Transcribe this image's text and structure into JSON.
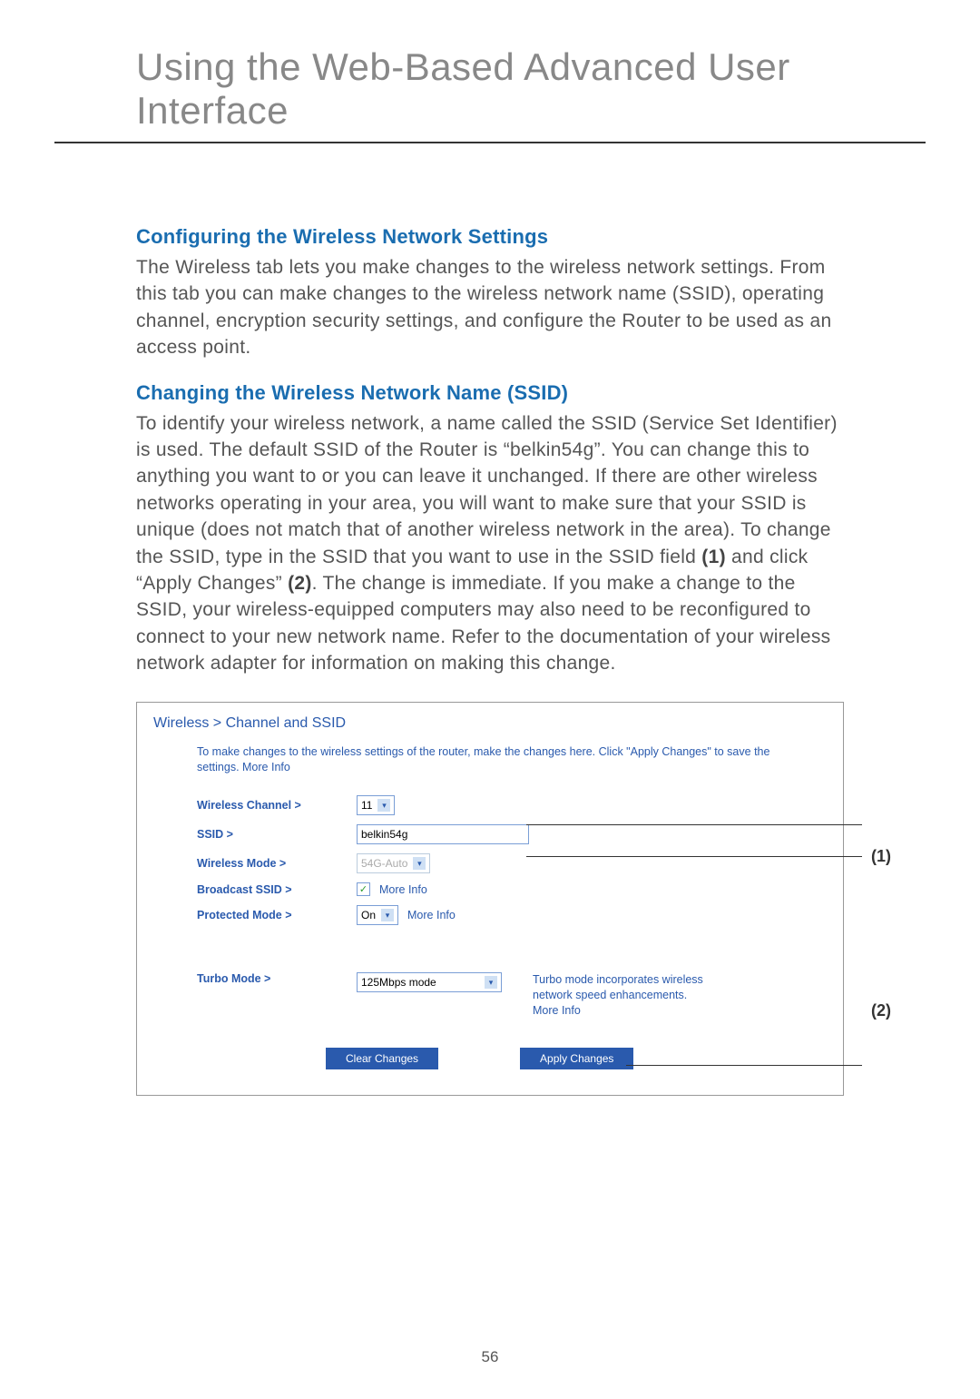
{
  "page_title": "Using the Web-Based Advanced User Interface",
  "page_number": "56",
  "sections": {
    "s1_heading": "Configuring the Wireless Network Settings",
    "s1_body": "The Wireless tab lets you make changes to the wireless network settings. From this tab you can make changes to the wireless network name (SSID), operating channel, encryption security settings, and configure the Router to be used as an access point.",
    "s2_heading": "Changing the Wireless Network Name (SSID)",
    "s2_body_a": "To identify your wireless network, a name called the SSID (Service Set Identifier) is used. The default SSID of the Router is “belkin54g”. You can change this to anything you want to or you can leave it unchanged. If there are other wireless networks operating in your area, you will want to make sure that your SSID is unique (does not match that of another wireless network in the area). To change the SSID, type in the SSID that you want to use in the SSID field ",
    "s2_ref1": "(1)",
    "s2_body_b": " and click “Apply Changes” ",
    "s2_ref2": "(2)",
    "s2_body_c": ". The change is immediate. If you make a change to the SSID, your wireless-equipped computers may also need to be reconfigured to connect to your new network name. Refer to the documentation of your wireless network adapter for information on making this change."
  },
  "callouts": {
    "c1": "(1)",
    "c2": "(2)"
  },
  "router_ui": {
    "breadcrumb": "Wireless > Channel and SSID",
    "intro": "To make changes to the wireless settings of the router, make the changes here. Click \"Apply Changes\" to save the settings. More Info",
    "labels": {
      "wireless_channel": "Wireless Channel >",
      "ssid": "SSID >",
      "wireless_mode": "Wireless Mode >",
      "broadcast_ssid": "Broadcast SSID >",
      "protected_mode": "Protected Mode >",
      "turbo_mode": "Turbo Mode >"
    },
    "values": {
      "wireless_channel": "11",
      "ssid": "belkin54g",
      "wireless_mode": "54G-Auto",
      "broadcast_checked": "✓",
      "protected_mode": "On",
      "turbo_mode": "125Mbps mode"
    },
    "more_info": "More Info",
    "turbo_desc": "Turbo mode incorporates wireless network speed enhancements. More Info",
    "buttons": {
      "clear": "Clear Changes",
      "apply": "Apply Changes"
    }
  }
}
